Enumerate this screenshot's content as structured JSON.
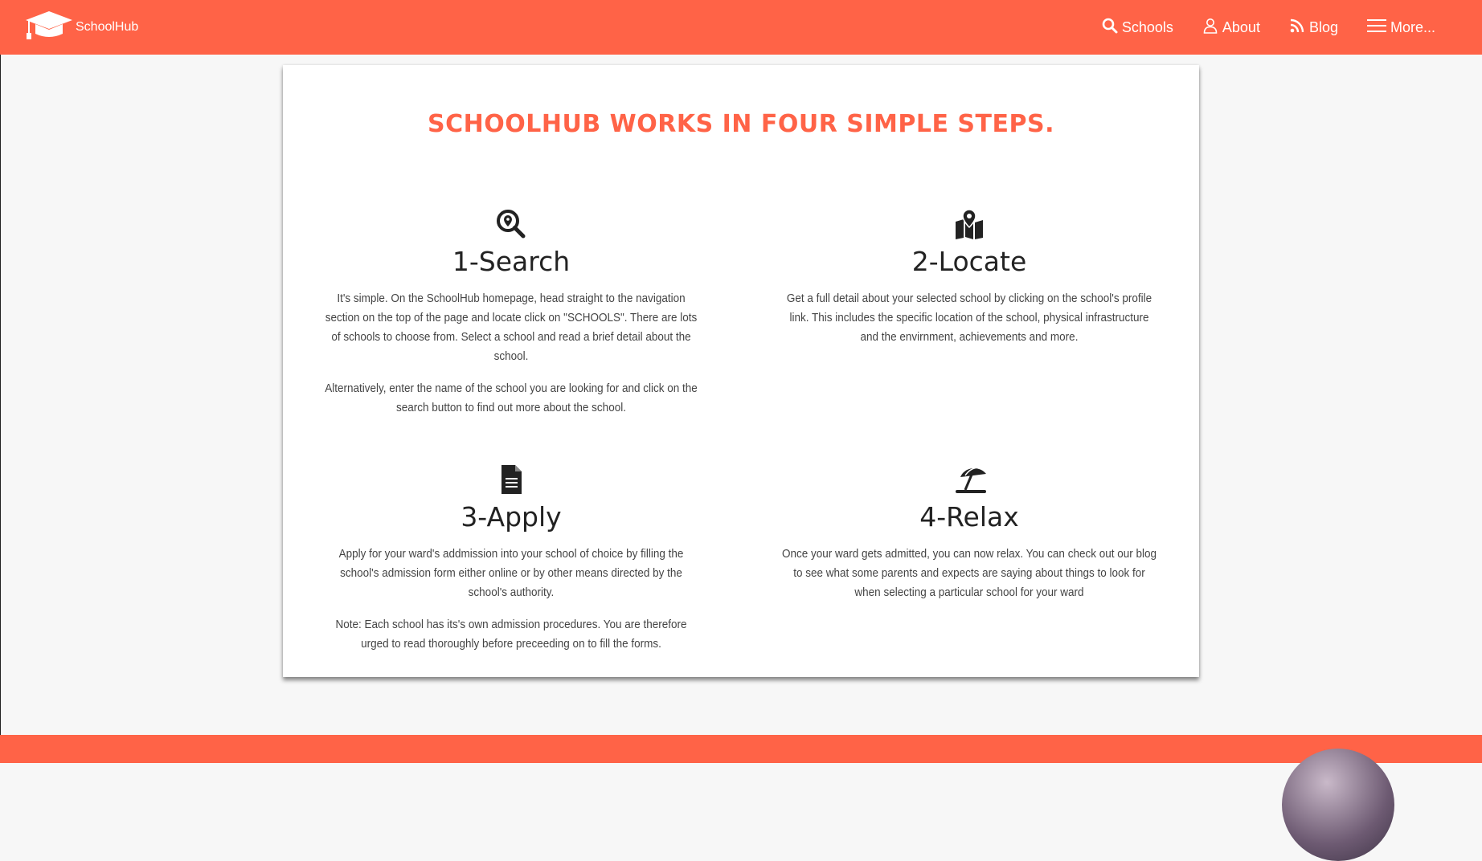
{
  "app": {
    "brand": "SchoolHub",
    "accent_color": "#ff6347"
  },
  "nav": {
    "items": [
      {
        "label": "Schools",
        "icon": "search-icon"
      },
      {
        "label": "About",
        "icon": "user-icon"
      },
      {
        "label": "Blog",
        "icon": "rss-icon"
      },
      {
        "label": "More...",
        "icon": "hamburger-menu-icon"
      }
    ]
  },
  "main": {
    "title": "SCHOOLHUB WORKS IN FOUR SIMPLE STEPS.",
    "steps": [
      {
        "icon": "search-location-icon",
        "heading": "1-Search",
        "paragraphs": [
          "It's simple. On the SchoolHub homepage, head straight to the navigation section on the top of the page and locate click on \"SCHOOLS\". There are lots of schools to choose from. Select a school and read a brief detail about the school.",
          "Alternatively, enter the name of the school you are looking for and click on the search button to find out more about the school."
        ]
      },
      {
        "icon": "map-marked-icon",
        "heading": "2-Locate",
        "paragraphs": [
          "Get a full detail about your selected school by clicking on the school's profile link. This includes the specific location of the school, physical infrastructure and the envirnment, achievements and more."
        ]
      },
      {
        "icon": "file-document-icon",
        "heading": "3-Apply",
        "paragraphs": [
          "Apply for your ward's addmission into your school of choice by filling the school's admission form either online or by other means directed by the school's authority.",
          "Note: Each school has its's own admission procedures. You are therefore urged to read thoroughly before preceeding on to fill the forms."
        ]
      },
      {
        "icon": "umbrella-beach-icon",
        "heading": "4-Relax",
        "paragraphs": [
          "Once your ward gets admitted, you can now relax. You can check out our blog to see what some parents and expects are saying about things to look for when selecting a particular school for your ward"
        ]
      }
    ]
  }
}
